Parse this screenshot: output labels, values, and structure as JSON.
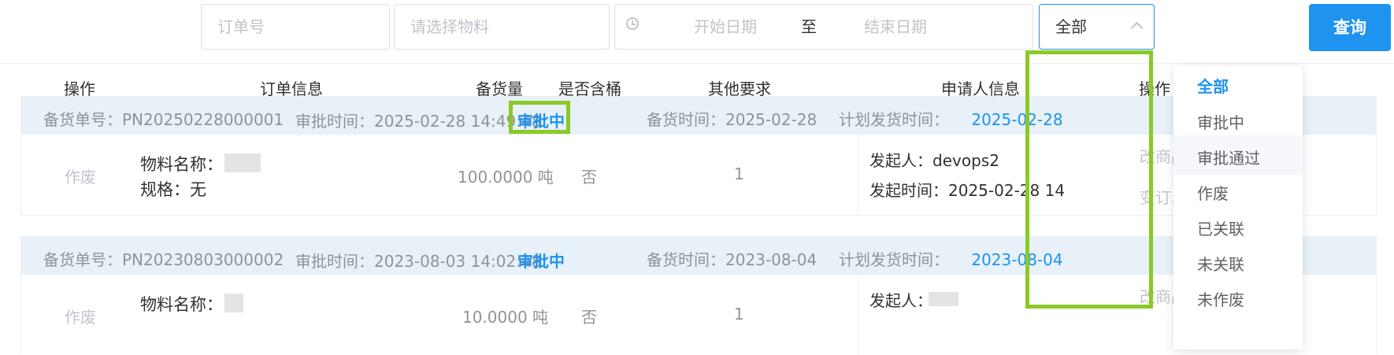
{
  "filters": {
    "order_no_placeholder": "订单号",
    "material_placeholder": "请选择物料",
    "start_date_placeholder": "开始日期",
    "range_separator": "至",
    "end_date_placeholder": "结束日期",
    "status_selected": "全部",
    "query_label": "查询"
  },
  "columns": [
    "操作",
    "订单信息",
    "备货量",
    "是否含桶",
    "其他要求",
    "申请人信息",
    "操作"
  ],
  "orders": [
    {
      "order_no_label": "备货单号：",
      "order_no": "PN20250228000001",
      "approve_time_label": "审批时间：",
      "approve_time": "2025-02-28 14:49:48",
      "status": "审批中",
      "stock_time_label": "备货时间：",
      "stock_time": "2025-02-28",
      "ship_time_label": "计划发货时间：",
      "ship_time": "2025-02-28",
      "action": "作废",
      "material_label": "物料名称：",
      "spec_label": "规格：",
      "spec": "无",
      "quantity": "100.0000 吨",
      "has_barrel": "否",
      "other": "1",
      "initiator_label": "发起人：",
      "initiator": "devops2",
      "initiate_time_label": "发起时间：",
      "initiate_time": "2025-02-28 14",
      "right_action_1": "改商品",
      "right_action_2": "变订单"
    },
    {
      "order_no_label": "备货单号：",
      "order_no": "PN20230803000002",
      "approve_time_label": "审批时间：",
      "approve_time": "2023-08-03 14:02:48",
      "status": "审批中",
      "stock_time_label": "备货时间：",
      "stock_time": "2023-08-04",
      "ship_time_label": "计划发货时间：",
      "ship_time": "2023-08-04",
      "action": "作废",
      "material_label": "物料名称：",
      "quantity": "10.0000 吨",
      "has_barrel": "否",
      "other": "1",
      "initiator_label": "发起人：",
      "right_action_1": "改商品"
    }
  ],
  "dropdown": {
    "options": [
      "全部",
      "审批中",
      "审批通过",
      "作废",
      "已关联",
      "未关联",
      "未作废"
    ],
    "selected_index": 0,
    "hovered_index": 2
  },
  "colors": {
    "primary": "#1e93f0",
    "highlight": "#8ac926",
    "row_header_bg": "#e8f1f8"
  }
}
